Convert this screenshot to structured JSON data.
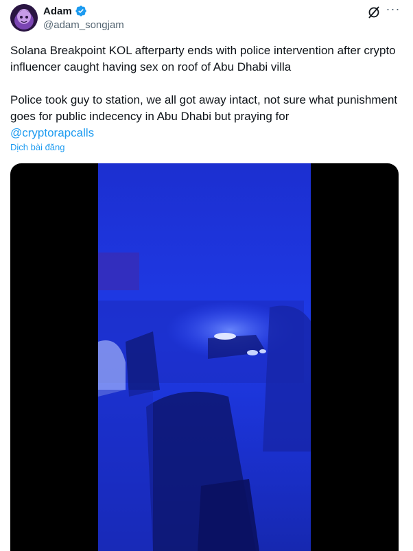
{
  "author": {
    "display_name": "Adam",
    "handle": "@adam_songjam",
    "verified": true,
    "avatar_icon": "avatar-image"
  },
  "header_actions": {
    "grok_icon": "grok-icon",
    "more_label": "···"
  },
  "tweet": {
    "paragraph1": "Solana Breakpoint KOL afterparty ends with police intervention after crypto influencer caught having sex on roof of Abu Dhabi villa",
    "paragraph2": "Police took guy to station, we all got away intact, not sure what punishment goes for public indecency in Abu Dhabi but praying for",
    "mention": "@cryptorapcalls",
    "translate_label": "Dịch bài đăng"
  },
  "media": {
    "type": "video",
    "description_icon": "video-thumbnail"
  },
  "colors": {
    "accent": "#1d9bf0",
    "text_primary": "#0f1419",
    "text_secondary": "#536471",
    "video_blue": "#1a2fd8"
  }
}
